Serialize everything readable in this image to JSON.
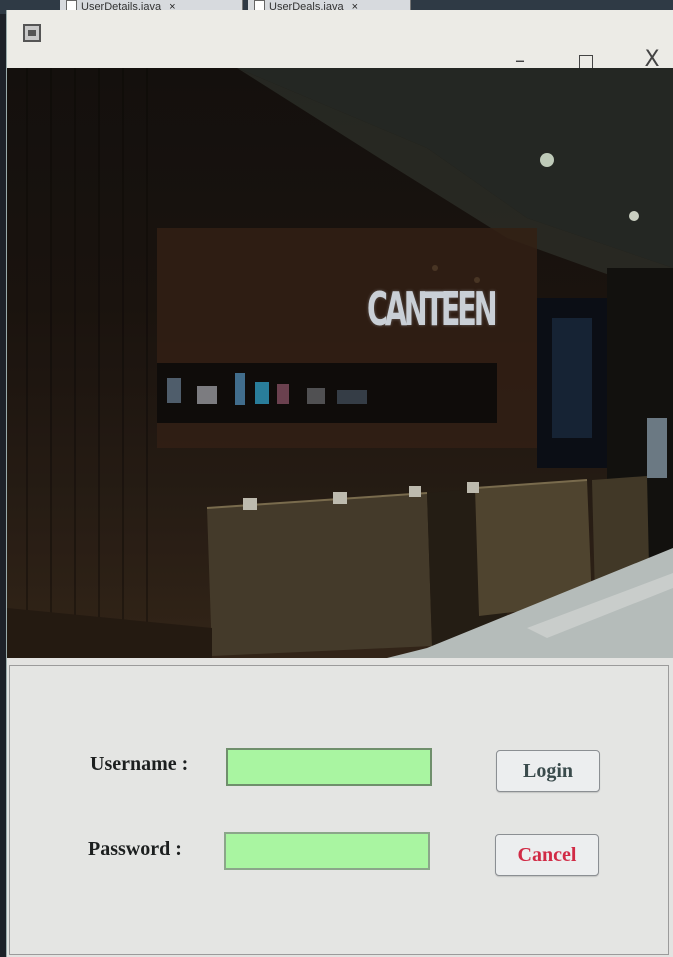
{
  "background_tabs": [
    {
      "label": "UserDetails.java",
      "close": "×"
    },
    {
      "label": "UserDeals.java",
      "close": "×"
    }
  ],
  "window": {
    "controls": {
      "minimize": "–",
      "maximize": "□",
      "close": "X"
    }
  },
  "photo": {
    "sign_text": "CANTEEN"
  },
  "login": {
    "username_label": "Username :",
    "username_value": "",
    "password_label": "Password  :",
    "password_value": "",
    "login_button": "Login",
    "cancel_button": "Cancel"
  },
  "colors": {
    "field_background": "#a9f5a1",
    "cancel_text": "#d12a45",
    "login_text": "#3a4b4c",
    "panel_background": "#e4e5e3"
  },
  "icons": [
    "app-window-icon",
    "minimize-icon",
    "maximize-icon",
    "close-icon",
    "file-icon"
  ]
}
